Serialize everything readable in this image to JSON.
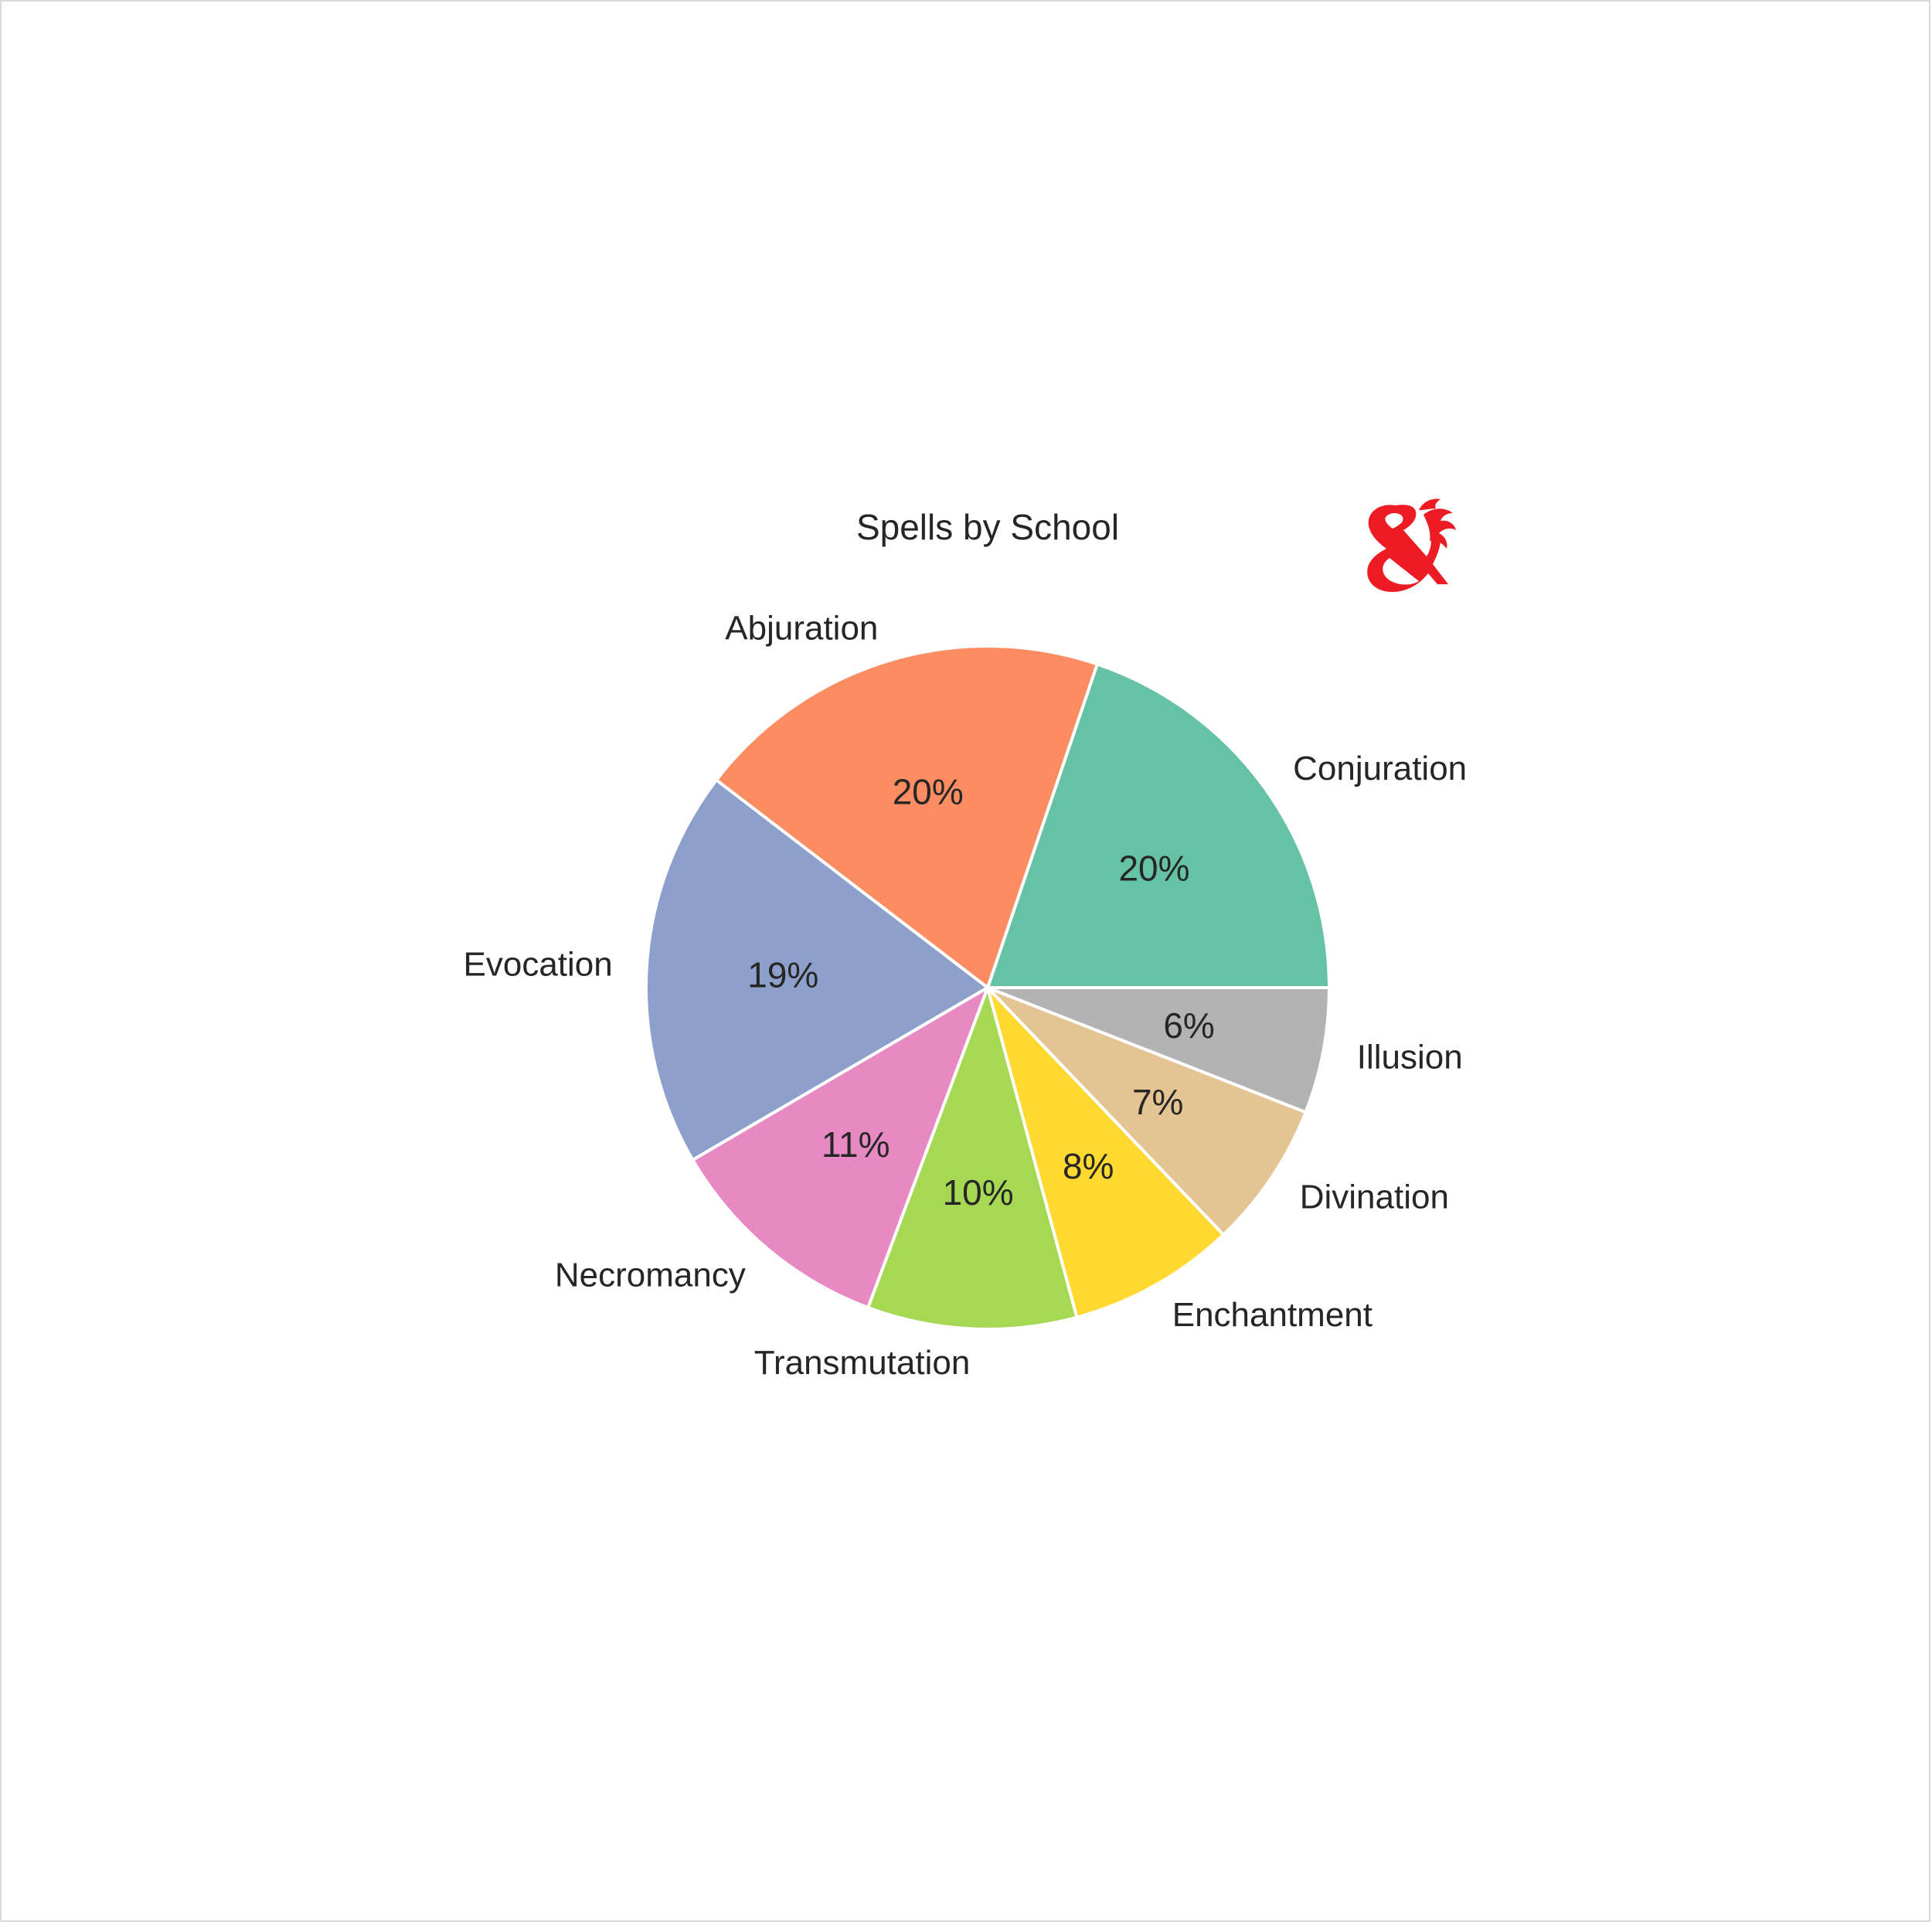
{
  "chart_data": {
    "type": "pie",
    "title": "Spells by School",
    "categories": [
      "Conjuration",
      "Abjuration",
      "Evocation",
      "Necromancy",
      "Transmutation",
      "Enchantment",
      "Divination",
      "Illusion"
    ],
    "values": [
      20,
      20,
      19,
      11,
      10,
      8,
      7,
      6
    ],
    "value_labels": [
      "20%",
      "20%",
      "19%",
      "11%",
      "10%",
      "8%",
      "7%",
      "6%"
    ],
    "colors": [
      "#66c2a5",
      "#fc8d62",
      "#8da0cb",
      "#e78ac3",
      "#a6d854",
      "#ffd92f",
      "#e5c494",
      "#b3b3b3"
    ],
    "start_angle_deg": 0,
    "direction": "counterclockwise",
    "legend": "none"
  },
  "logo": {
    "icon": "dnd-ampersand-dragon-icon",
    "color": "#ed1c24"
  }
}
